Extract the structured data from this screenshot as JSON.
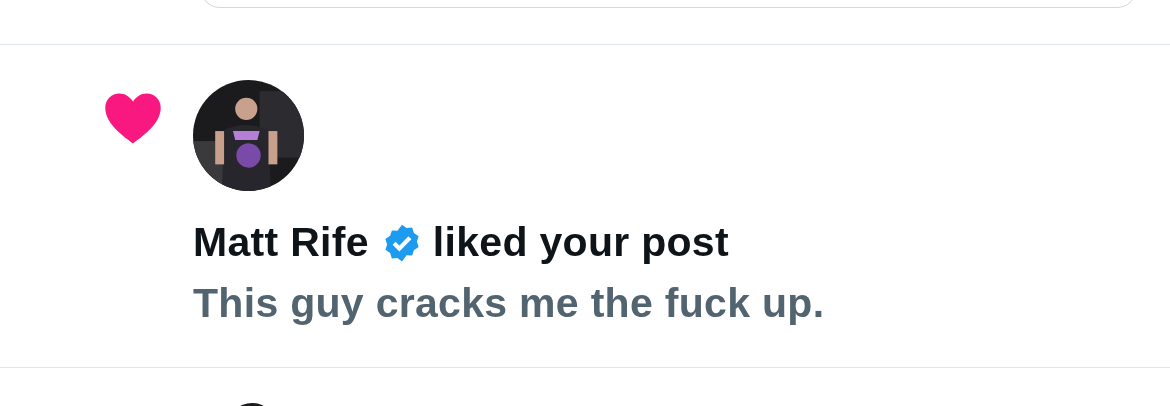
{
  "notification": {
    "kind": "like",
    "actor_name": "Matt Rife",
    "verified": true,
    "action_text": "liked your post",
    "post_text": "This guy cracks me the fuck up."
  }
}
